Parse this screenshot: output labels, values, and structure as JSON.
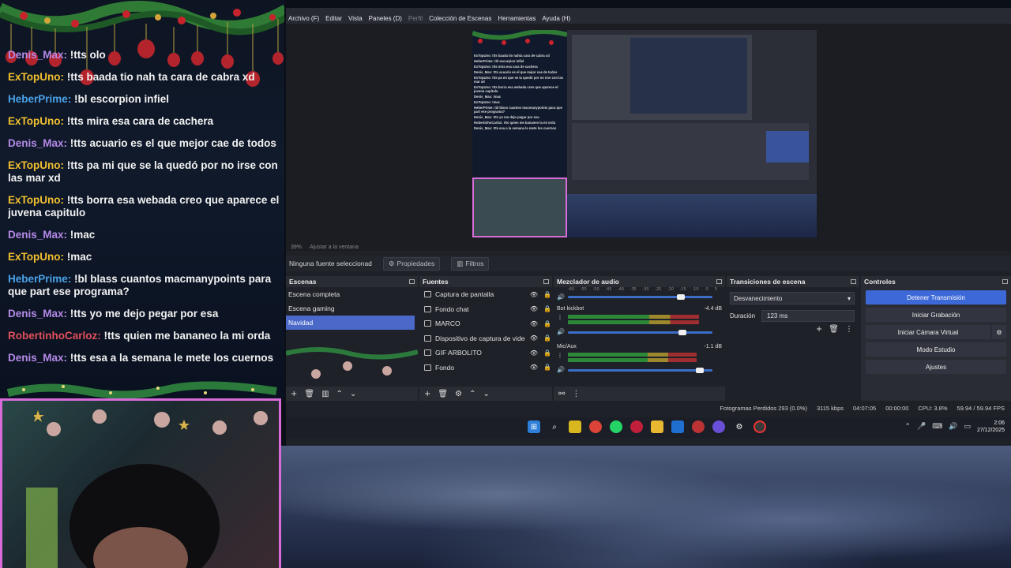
{
  "chat": {
    "messages": [
      {
        "user": "Denis_Max:",
        "text": " !tts olo",
        "color": "#b58ae8"
      },
      {
        "user": "ExTopUno:",
        "text": " !tts baada tio nah ta cara de cabra xd",
        "color": "#f2c02f"
      },
      {
        "user": "HeberPrime:",
        "text": " !bl escorpion infiel",
        "color": "#4aa3ea"
      },
      {
        "user": "ExTopUno:",
        "text": " !tts mira esa cara de cachera",
        "color": "#f2c02f"
      },
      {
        "user": "Denis_Max:",
        "text": " !tts acuario es el que mejor cae de todos",
        "color": "#b58ae8"
      },
      {
        "user": "ExTopUno:",
        "text": " !tts pa mi que se la quedó por no irse con las mar xd",
        "color": "#f2c02f"
      },
      {
        "user": "ExTopUno:",
        "text": " !tts borra esa webada creo que aparece el juvena capitulo",
        "color": "#f2c02f"
      },
      {
        "user": "Denis_Max:",
        "text": " !mac",
        "color": "#b58ae8"
      },
      {
        "user": "ExTopUno:",
        "text": " !mac",
        "color": "#f2c02f"
      },
      {
        "user": "HeberPrime:",
        "text": " !bl blass cuantos macmanypoints para que part ese programa?",
        "color": "#4aa3ea"
      },
      {
        "user": "Denis_Max:",
        "text": " !tts yo me dejo pegar por esa",
        "color": "#b58ae8"
      },
      {
        "user": "RobertinhoCarloz:",
        "text": " !tts quien me bananeo la mi orda",
        "color": "#e0505a"
      },
      {
        "user": "Denis_Max:",
        "text": " !tts esa a la semana le mete los cuernos",
        "color": "#b58ae8"
      }
    ]
  },
  "obs": {
    "menu": {
      "items": [
        "Archivo (F)",
        "Editar",
        "Vista",
        "Paneles (D)"
      ],
      "disabled": "Perfil",
      "items2": [
        "Colección de Escenas",
        "Herramientas",
        "Ayuda (H)"
      ]
    },
    "zoom": {
      "value": "39%",
      "fit": "Ajustar a la ventana"
    },
    "toolbar": {
      "no_source": "Ninguna fuente seleccionad",
      "properties": "Propiedades",
      "filters": "Filtros"
    },
    "scenes": {
      "title": "Escenas",
      "items": [
        "Escena completa",
        "Escena gaming",
        "Navidad"
      ],
      "active_index": 2
    },
    "sources": {
      "title": "Fuentes",
      "items": [
        "Captura de pantalla",
        "Fondo chat",
        "MARCO",
        "Dispositivo de captura de video",
        "GIF ARBOLITO",
        "Fondo"
      ]
    },
    "mixer": {
      "title": "Mezclador de audio",
      "scale": [
        "-60",
        "-55",
        "-50",
        "-45",
        "-40",
        "-35",
        "-30",
        "-25",
        "-20",
        "-15",
        "-10",
        "-5",
        "0"
      ],
      "channels": [
        {
          "name": "Bot kickbot",
          "db": "-4.4 dB",
          "level": 0.88,
          "volume": 0.92
        },
        {
          "name": "Mic/Aux",
          "db": "-1.1 dB",
          "level": 0.86,
          "volume": 0.95
        }
      ]
    },
    "transitions": {
      "title": "Transiciones de escena",
      "selected": "Desvanecimiento",
      "duration_label": "Duración",
      "duration_value": "123 ms"
    },
    "controls": {
      "title": "Controles",
      "buttons": [
        "Detener Transmisión",
        "Iniciar Grabación",
        "Iniciar Cámara Virtual",
        "Modo Estudio",
        "Ajustes"
      ]
    },
    "status": {
      "dropped": "Fotogramas Perdidos 293 (0.0%)",
      "bitrate": "3115 kbps",
      "stream_time": "04:07:05",
      "rec_time": "00:00:00",
      "cpu": "CPU: 3.8%",
      "fps": "59.94 / 59.94 FPS"
    },
    "clock": {
      "time": "2:06",
      "date": "27/12/2025"
    }
  },
  "preview_chat": [
    "ExTopUno: !tts baada tio nahta cara de cabra xd",
    "HeberPrime: !bl escorpion infiel",
    "ExTopUno: !tts mira esa cara de cachera",
    "Denis_Max: !tts acuario es el que mejor cae de todos",
    "ExTopUno: !tts pa mi que se la quedó por no irse con las mar xd",
    "ExTopUno: !tts borra esa webada creo que aparece el juvena capitulo",
    "Denis_Max: !mac",
    "ExTopUno: !mac",
    "HeberPrime: !bl blass cuantos macmanypoints para que part ese programa?",
    "Denis_Max: !tts yo me dejo pegar por esa",
    "RobertinhoCarloz: !tts quien me bananeo la mi orda",
    "Denis_Max: !tts esa a la semana le mete los cuernos"
  ]
}
